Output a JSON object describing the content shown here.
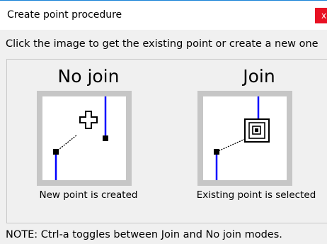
{
  "dialog": {
    "title": "Create point procedure",
    "close_label": "x",
    "accent_color": "#1883d7",
    "close_color": "#e81123"
  },
  "instruction": "Click the image to get the existing point or create a new one",
  "options": [
    {
      "title": "No join",
      "caption": "New point is created",
      "icon": "no-join-cross-cursor-icon"
    },
    {
      "title": "Join",
      "caption": "Existing point is selected",
      "icon": "join-square-snap-icon"
    }
  ],
  "note": "NOTE: Ctrl-a toggles between Join and No join modes.",
  "colors": {
    "line_blue": "#0000ff",
    "frame_gray": "#c6c6c6"
  }
}
